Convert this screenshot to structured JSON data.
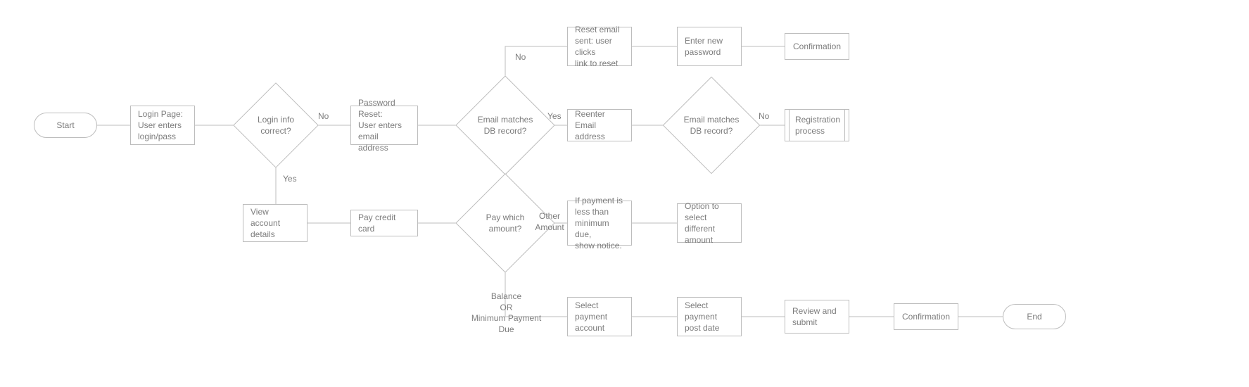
{
  "nodes": {
    "start": "Start",
    "login": "Login Page:\nUser enters\nlogin/pass",
    "loginCorrect": "Login info\ncorrect?",
    "pwReset": "Password Reset:\nUser enters\nemail address",
    "emailMatch1": "Email matches\nDB record?",
    "resetEmail": "Reset email\nsent: user clicks\nlink to reset",
    "enterNewPw": "Enter new\npassword",
    "conf1": "Confirmation",
    "reenterEmail": "Reenter Email\naddress",
    "emailMatch2": "Email matches\nDB record?",
    "registration": "Registration\nprocess",
    "viewAcct": "View account\ndetails",
    "payCC": "Pay credit card",
    "payWhich": "Pay which\namount?",
    "notice": "If payment is\nless than\nminimum due,\nshow notice.",
    "optionDiff": "Option to\nselect different\namount",
    "selectAcct": "Select\npayment\naccount",
    "selectDate": "Select\npayment\npost date",
    "review": "Review and\nsubmit",
    "conf2": "Confirmation",
    "end": "End"
  },
  "edges": {
    "loginNo": "No",
    "loginYes": "Yes",
    "email1No": "No",
    "email1Yes": "Yes",
    "email2No": "No",
    "payOther": "Other\nAmount",
    "payBalance": "Balance\nOR\nMinimum Payment\nDue"
  }
}
